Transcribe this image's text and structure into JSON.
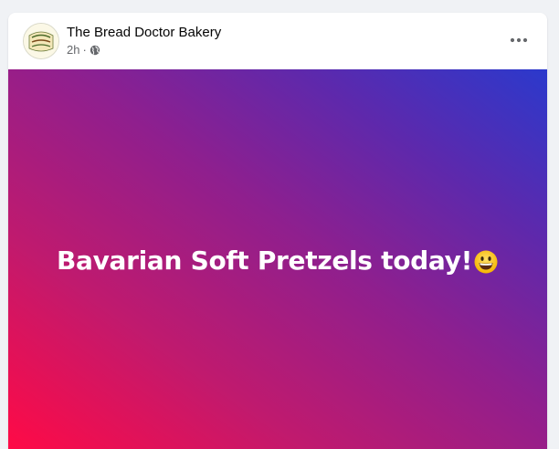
{
  "post": {
    "page_name": "The Bread Doctor Bakery",
    "timestamp": "2h",
    "separator": "·",
    "privacy_icon": "globe-icon",
    "more_icon": "more-options-icon",
    "avatar_icon": "bakery-logo",
    "text": "Bavarian Soft Pretzels today!",
    "emoji_icon": "grinning-face-emoji",
    "background_gradient": [
      "#ff0a46",
      "#8f1f8e",
      "#2b39cc"
    ]
  }
}
